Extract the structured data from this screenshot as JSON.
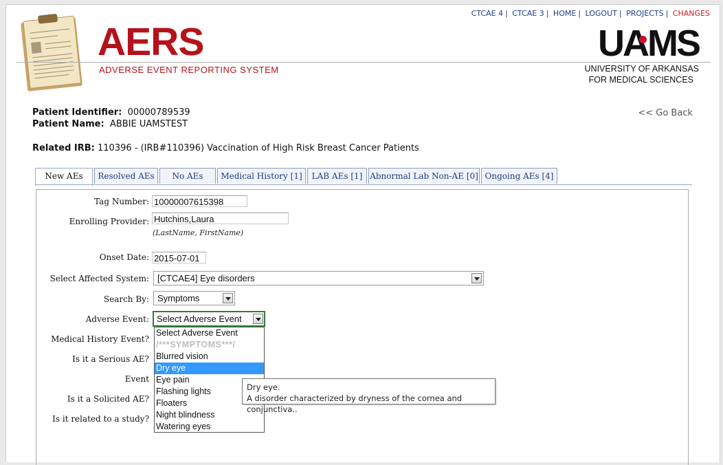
{
  "nav": {
    "links": [
      "CTCAE 4",
      "CTCAE 3",
      "HOME",
      "LOGOUT",
      "PROJECTS",
      "CHANGES"
    ]
  },
  "branding": {
    "title": "AERS",
    "subtitle": "ADVERSE EVENT REPORTING SYSTEM",
    "org_logo": "UAMS",
    "org_line1": "UNIVERSITY OF ARKANSAS",
    "org_line2": "FOR MEDICAL SCIENCES"
  },
  "patient": {
    "identifier_label": "Patient Identifier:",
    "identifier": "00000789539",
    "name_label": "Patient Name:",
    "name": "ABBIE UAMSTEST",
    "irb_label": "Related IRB:",
    "irb": "110396  - (IRB#110396) Vaccination of High Risk Breast Cancer Patients",
    "go_back": "<< Go Back"
  },
  "tabs": [
    "New AEs",
    "Resolved AEs",
    "No AEs",
    "Medical History [1]",
    "LAB AEs [1]",
    "Abnormal Lab Non-AE [0]",
    "Ongoing AEs [4]"
  ],
  "form": {
    "tag_label": "Tag Number:",
    "tag_value": "10000007615398",
    "provider_label": "Enrolling Provider:",
    "provider_value": "Hutchins,Laura",
    "provider_hint": "(LastName, FirstName)",
    "onset_label": "Onset Date:",
    "onset_value": "2015-07-01",
    "system_label": "Select Affected System:",
    "system_value": "[CTCAE4] Eye disorders",
    "search_label": "Search By:",
    "search_value": "Symptoms",
    "ae_label": "Adverse Event:",
    "ae_value": "Select Adverse Event",
    "medhist_label": "Medical History Event?",
    "serious_label": "Is it a Serious AE?",
    "event_label": "Event",
    "solicited_label": "Is it a Solicited AE?",
    "related_label": "Is it related to a study?"
  },
  "dropdown": {
    "options": [
      "Select Adverse Event",
      "/***SYMPTOMS***/",
      "Blurred vision",
      "Dry eye",
      "Eye pain",
      "Flashing lights",
      "Floaters",
      "Night blindness",
      "Watering eyes"
    ],
    "highlighted": "Dry eye"
  },
  "tooltip": {
    "line1": "Dry eye.",
    "line2": "A disorder characterized by dryness of the cornea and conjunctiva.."
  },
  "colors": {
    "brand_red": "#b5121b",
    "link_blue": "#1b3c8c",
    "highlight": "#3399ff",
    "focus_green": "#2f7d2f"
  }
}
